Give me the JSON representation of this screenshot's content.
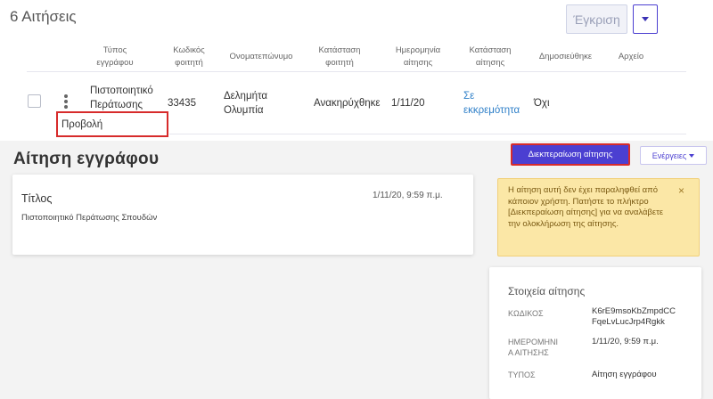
{
  "list": {
    "count_title": "6 Αιτήσεις",
    "approve_button": "Έγκριση",
    "columns": [
      "Τύπος\nεγγράφου",
      "Κωδικός\nφοιτητή",
      "Ονοματεπώνυμο",
      "Κατάσταση\nφοιτητή",
      "Ημερομηνία\nαίτησης",
      "Κατάσταση\nαίτησης",
      "Δημοσιεύθηκε",
      "Αρχείο"
    ],
    "row": {
      "doc_type": "Πιστοποιητικό\nΠεράτωσης",
      "student_code": "33435",
      "full_name": "Δελημήτα\nΟλυμπία",
      "student_status": "Ανακηρύχθηκε",
      "request_date": "1/11/20",
      "request_status": "Σε\nεκκρεμότητα",
      "published": "Όχι"
    },
    "row_menu_view": "Προβολή"
  },
  "detail": {
    "title": "Αίτηση εγγράφου",
    "process_button": "Διεκπεραίωση αίτησης",
    "actions_button": "Ενέργειες",
    "card": {
      "label": "Τίτλος",
      "date": "1/11/20, 9:59 π.μ.",
      "value": "Πιστοποιητικό Περάτωσης Σπουδών"
    },
    "alert": {
      "text": "Η αίτηση αυτή δεν έχει παραληφθεί από κάποιον χρήστη. Πατήστε το πλήκτρο [Διεκπεραίωση αίτησης] για να αναλάβετε την ολοκλήρωση της αίτησης.",
      "close": "×"
    },
    "info": {
      "title": "Στοιχεία αίτησης",
      "code_label": "ΚΩΔΙΚΟΣ",
      "code_value": "K6rE9msoKbZmpdCC\nFqeLvLucJrp4Rgkk",
      "date_label": "ΗΜΕΡΟΜΗΝΙ\nΑ ΑΙΤΗΣΗΣ",
      "date_value": "1/11/20, 9:59 π.μ.",
      "type_label": "ΤΥΠΟΣ",
      "type_value": "Αίτηση εγγράφου"
    }
  },
  "colors": {
    "accent": "#4b3fd1",
    "highlight_border": "#d72b2b",
    "link": "#2e7fc8",
    "alert_bg": "#fbe7a6"
  }
}
